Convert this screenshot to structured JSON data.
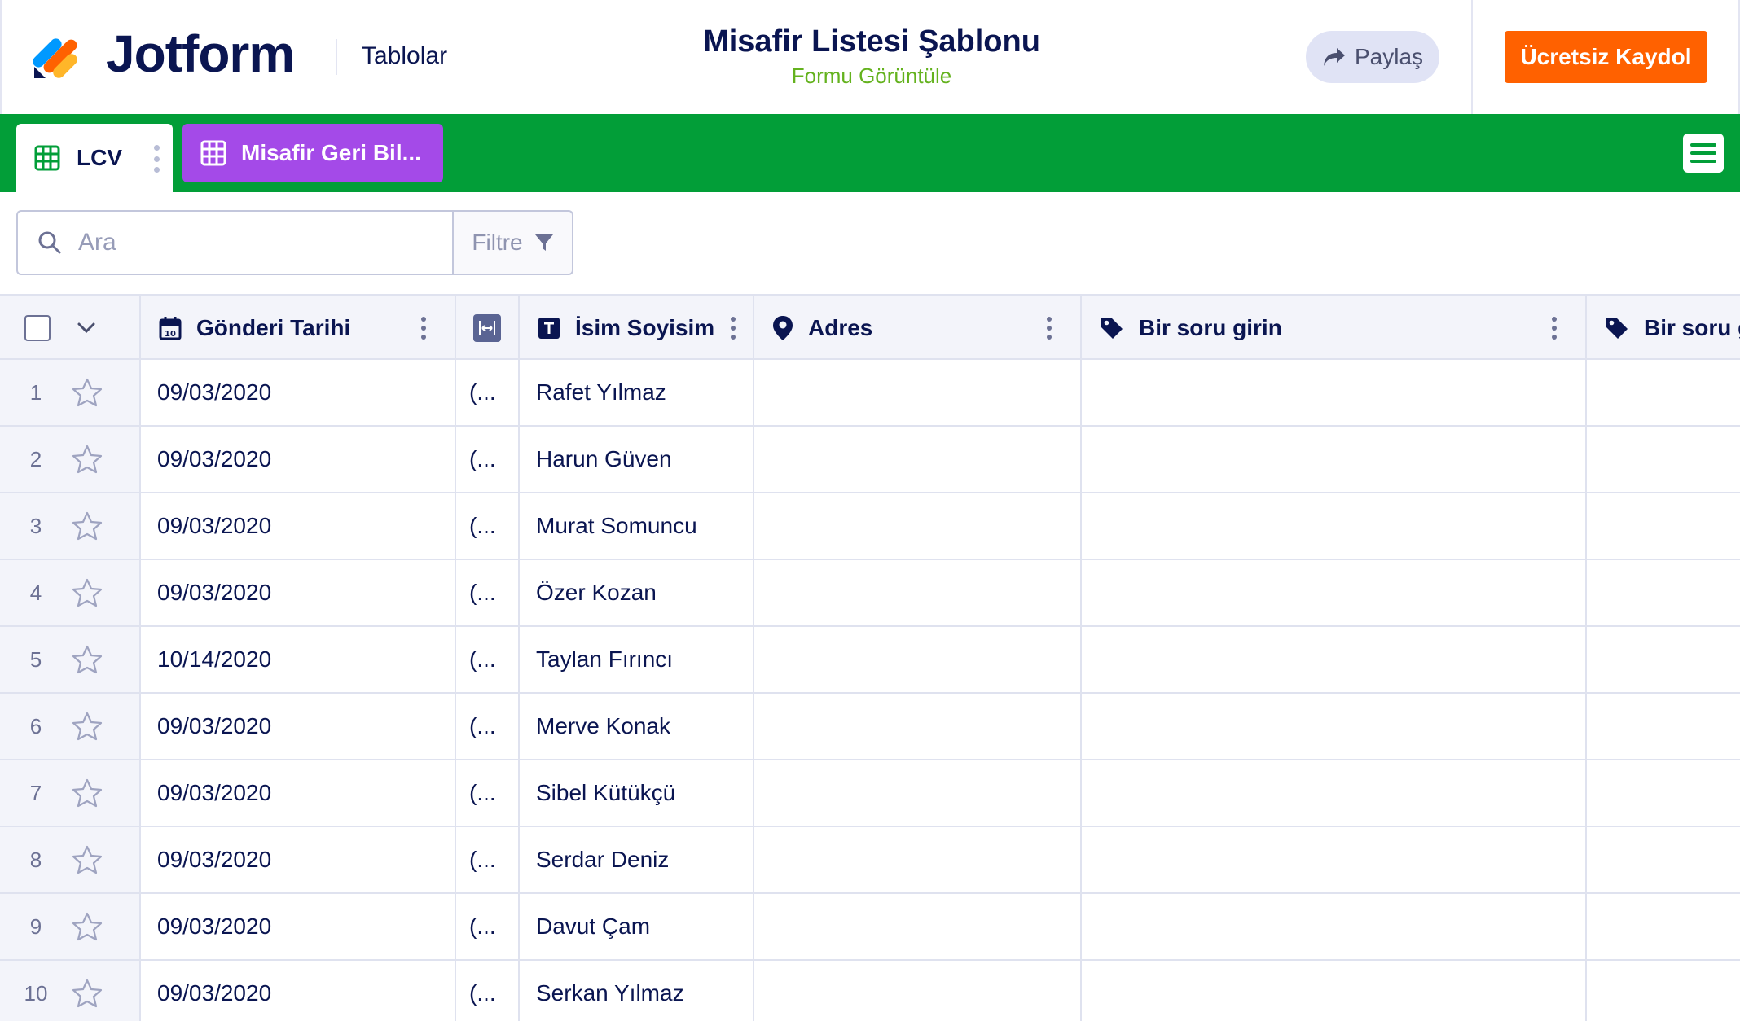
{
  "header": {
    "brand": "Jotform",
    "section_link": "Tablolar",
    "title": "Misafir Listesi Şablonu",
    "view_form_link": "Formu Görüntüle",
    "share_label": "Paylaş",
    "signup_label": "Ücretsiz Kaydol"
  },
  "tabs": [
    {
      "label": "LCV",
      "active": true
    },
    {
      "label": "Misafir Geri Bil...",
      "active": false
    }
  ],
  "search": {
    "placeholder": "Ara",
    "filter_label": "Filtre"
  },
  "table": {
    "columns": [
      {
        "label": "Gönderi Tarihi",
        "icon": "calendar-icon"
      },
      {
        "label": "",
        "icon": "expand-width-icon"
      },
      {
        "label": "İsim Soyisim",
        "icon": "text-type-icon"
      },
      {
        "label": "Adres",
        "icon": "location-pin-icon"
      },
      {
        "label": "Bir soru girin",
        "icon": "tag-icon"
      },
      {
        "label": "Bir soru g",
        "icon": "tag-icon"
      }
    ],
    "rows": [
      {
        "num": "1",
        "date": "09/03/2020",
        "short": "(...",
        "name": "Rafet Yılmaz"
      },
      {
        "num": "2",
        "date": "09/03/2020",
        "short": "(...",
        "name": "Harun Güven"
      },
      {
        "num": "3",
        "date": "09/03/2020",
        "short": "(...",
        "name": "Murat Somuncu"
      },
      {
        "num": "4",
        "date": "09/03/2020",
        "short": "(...",
        "name": "Özer Kozan"
      },
      {
        "num": "5",
        "date": "10/14/2020",
        "short": "(...",
        "name": "Taylan Fırıncı"
      },
      {
        "num": "6",
        "date": "09/03/2020",
        "short": "(...",
        "name": "Merve Konak"
      },
      {
        "num": "7",
        "date": "09/03/2020",
        "short": "(...",
        "name": "Sibel Kütükçü"
      },
      {
        "num": "8",
        "date": "09/03/2020",
        "short": "(...",
        "name": "Serdar Deniz"
      },
      {
        "num": "9",
        "date": "09/03/2020",
        "short": "(...",
        "name": "Davut Çam"
      },
      {
        "num": "10",
        "date": "09/03/2020",
        "short": "(...",
        "name": "Serkan Yılmaz"
      }
    ]
  },
  "colors": {
    "brand_navy": "#0a1551",
    "tabbar_green": "#029e38",
    "tab_purple": "#a44ae8",
    "signup_orange": "#ff6100",
    "view_form_green": "#64b21e"
  }
}
